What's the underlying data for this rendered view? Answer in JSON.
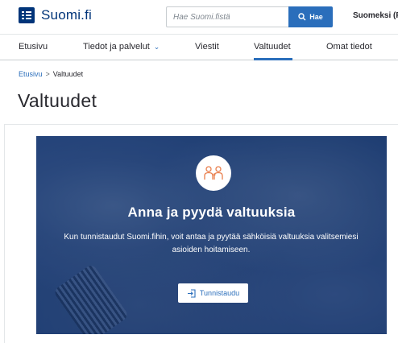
{
  "header": {
    "logo_text": "Suomi.fi",
    "search": {
      "placeholder": "Hae Suomi.fistä",
      "button_label": "Hae"
    },
    "language": "Suomeksi (FI"
  },
  "nav": {
    "items": [
      {
        "label": "Etusivu"
      },
      {
        "label": "Tiedot ja palvelut",
        "has_dropdown": true
      },
      {
        "label": "Viestit"
      },
      {
        "label": "Valtuudet",
        "active": true
      },
      {
        "label": "Omat tiedot"
      }
    ]
  },
  "breadcrumb": {
    "home": "Etusivu",
    "separator": ">",
    "current": "Valtuudet"
  },
  "page": {
    "title": "Valtuudet"
  },
  "hero": {
    "icon": "people-icon",
    "title": "Anna ja pyydä valtuuksia",
    "description": "Kun tunnistaudut Suomi.fihin, voit antaa ja pyytää sähköisiä valtuuksia valitsemiesi asioiden hoitamiseen.",
    "button_label": "Tunnistaudu",
    "button_icon": "login-icon"
  },
  "colors": {
    "brand": "#003479",
    "accent": "#2a6ebb",
    "hero_bg": "#244477",
    "icon_accent": "#e97e4c",
    "text": "#29292f"
  }
}
